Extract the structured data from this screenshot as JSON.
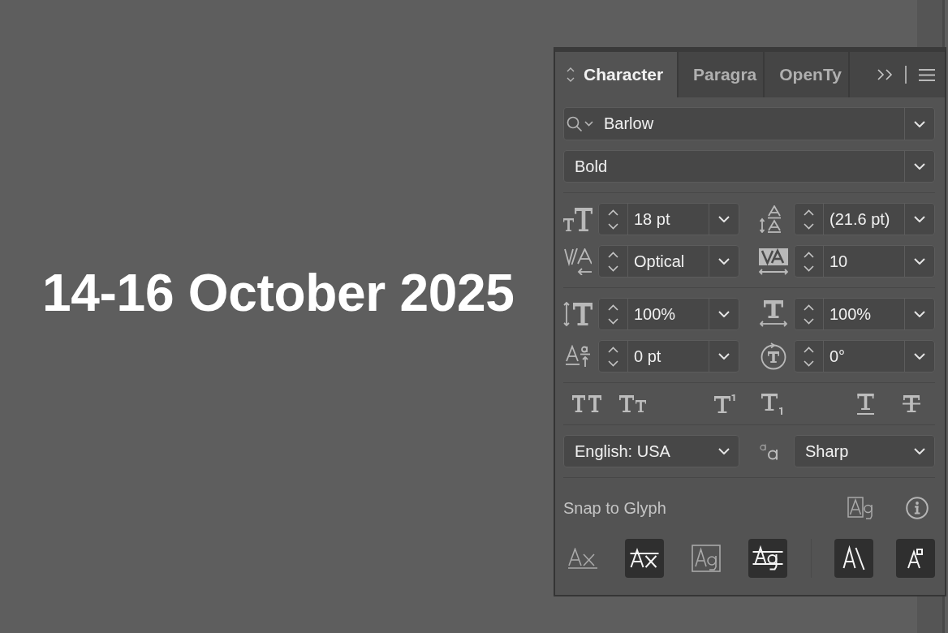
{
  "artboard": {
    "heading": "14-16 October 2025"
  },
  "panel": {
    "tabs": [
      {
        "label": "Character",
        "selected": true
      },
      {
        "label": "Paragra",
        "selected": false
      },
      {
        "label": "OpenTy",
        "selected": false
      }
    ],
    "font_family": {
      "value": "Barlow"
    },
    "font_style": {
      "value": "Bold"
    },
    "metric_groups": [
      {
        "fields": [
          {
            "kind": "size",
            "value": "18 pt"
          },
          {
            "kind": "leading",
            "value": "(21.6 pt)"
          },
          {
            "kind": "kerning",
            "value": "Optical"
          },
          {
            "kind": "tracking",
            "value": "10"
          }
        ]
      },
      {
        "fields": [
          {
            "kind": "vertical_scale",
            "value": "100%"
          },
          {
            "kind": "horizontal_scale",
            "value": "100%"
          },
          {
            "kind": "baseline_shift",
            "value": "0 pt"
          },
          {
            "kind": "rotation",
            "value": "0°"
          }
        ]
      }
    ],
    "type_toggles": [
      {
        "kind": "all_caps",
        "on": false
      },
      {
        "kind": "small_caps",
        "on": false
      },
      {
        "kind": "superscript",
        "on": false
      },
      {
        "kind": "subscript",
        "on": false
      },
      {
        "kind": "underline",
        "on": false
      },
      {
        "kind": "strikethrough",
        "on": false
      }
    ],
    "language": {
      "value": "English: USA"
    },
    "antialiasing": {
      "value": "Sharp"
    },
    "snap_to_glyph": {
      "label": "Snap to Glyph",
      "groups": [
        {
          "buttons": [
            {
              "kind": "baseline",
              "on": false
            },
            {
              "kind": "x_height",
              "on": true
            },
            {
              "kind": "glyph_bounds",
              "on": false
            },
            {
              "kind": "proximity",
              "on": true
            }
          ]
        },
        {
          "buttons": [
            {
              "kind": "angular",
              "on": true
            },
            {
              "kind": "anchor_point",
              "on": true
            }
          ]
        }
      ]
    }
  }
}
